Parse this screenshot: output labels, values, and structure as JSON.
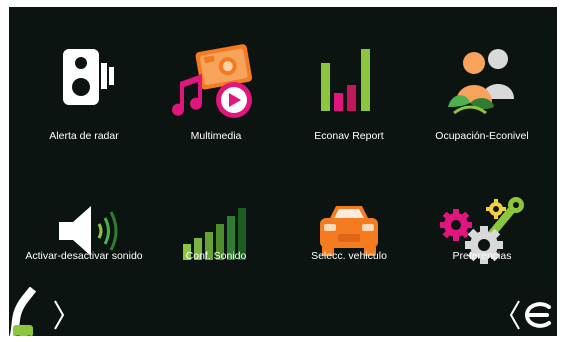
{
  "menu": {
    "items": [
      {
        "id": "radar",
        "label": "Alerta de radar"
      },
      {
        "id": "multimedia",
        "label": "Multimedia"
      },
      {
        "id": "econav",
        "label": "Econav Report"
      },
      {
        "id": "occupancy",
        "label": "Ocupación-Econivel"
      },
      {
        "id": "sound-toggle",
        "label": "Activar-desactivar sonido"
      },
      {
        "id": "sound-config",
        "label": "Conf. Sonido"
      },
      {
        "id": "vehicle",
        "label": "Selecc. vehiculo"
      },
      {
        "id": "preferences",
        "label": "Preferencias"
      }
    ]
  },
  "nav": {
    "left_icon": "road-car-icon",
    "right_icon": "econav-logo-icon"
  },
  "colors": {
    "background": "#0c1411",
    "green": "#8cc63f",
    "magenta": "#e0157e",
    "orange": "#f47b20",
    "white": "#ffffff"
  }
}
